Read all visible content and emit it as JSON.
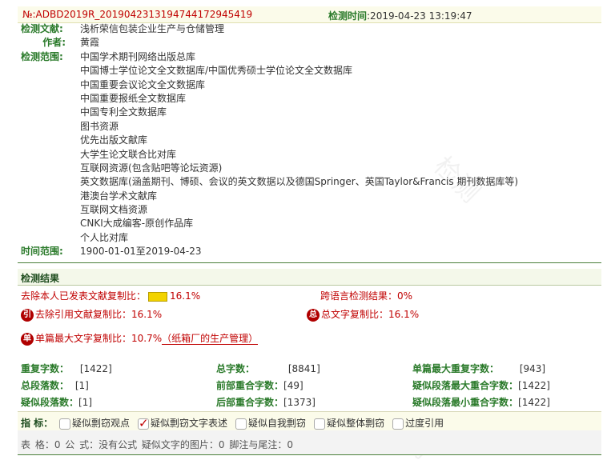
{
  "header": {
    "report_id": "№:ADBD2019R_2019042313194744172945419",
    "date_label": "检测时间",
    "date_value": ":2019-04-23 13:19:47"
  },
  "meta": {
    "doc_label": "检测文献:",
    "doc_value": "浅析荣信包装企业生产与仓储管理",
    "author_label": "作者:",
    "author_value": "黄霞",
    "scope_label": "检测范围:",
    "scope_items": [
      "中国学术期刊网络出版总库",
      "中国博士学位论文全文数据库/中国优秀硕士学位论文全文数据库",
      "中国重要会议论文全文数据库",
      "中国重要报纸全文数据库",
      "中国专利全文数据库",
      "图书资源",
      "优先出版文献库",
      "大学生论文联合比对库",
      "互联网资源(包含贴吧等论坛资源)",
      "英文数据库(涵盖期刊、博硕、会议的英文数据以及德国Springer、英国Taylor&Francis 期刊数据库等)",
      "港澳台学术文献库",
      "互联网文档资源",
      "CNKI大成编客-原创作品库",
      "个人比对库"
    ],
    "time_label": "时间范围:",
    "time_value": "1900-01-01至2019-04-23"
  },
  "results": {
    "title": "检测结果",
    "self_rate_label": "去除本人已发表文献复制比：",
    "self_rate_value": "16.1%",
    "cross_label": "跨语言检测结果：",
    "cross_value": "0%",
    "cite_icon": "引",
    "cite_label": "去除引用文献复制比：",
    "cite_value": "16.1%",
    "total_icon": "总",
    "total_label": "总文字复制比：",
    "total_value": "16.1%",
    "single_icon": "单",
    "single_label": "单篇最大文字复制比：",
    "single_value": "10.7%",
    "single_link": "（纸箱厂的生产管理）"
  },
  "stats": {
    "dup_chars_label": "重复字数：",
    "dup_chars_value": "[1422]",
    "total_chars_label": "总字数：",
    "total_chars_value": "[8841]",
    "single_max_dup_label": "单篇最大重复字数：",
    "single_max_dup_value": "[943]",
    "total_paras_label": "总段落数：",
    "total_paras_value": "[1]",
    "front_overlap_label": "前部重合字数：",
    "front_overlap_value": "[49]",
    "para_max_overlap_label": "疑似段落最大重合字数：",
    "para_max_overlap_value": "[1422]",
    "susp_paras_label": "疑似段落数：",
    "susp_paras_value": "[1]",
    "back_overlap_label": "后部重合字数：",
    "back_overlap_value": "[1373]",
    "para_min_overlap_label": "疑似段落最小重合字数：",
    "para_min_overlap_value": "[1422]"
  },
  "indicators": {
    "label": "指 标：",
    "items": [
      {
        "label": "疑似剽窃观点",
        "checked": false
      },
      {
        "label": "疑似剽窃文字表述",
        "checked": true
      },
      {
        "label": "疑似自我剽窃",
        "checked": false
      },
      {
        "label": "疑似整体剽窃",
        "checked": false
      },
      {
        "label": "过度引用",
        "checked": false
      }
    ]
  },
  "footer": {
    "text": "表 格：0    公 式：没有公式    疑似文字的图片：0    脚注与尾注：0"
  },
  "colors": {
    "accent_red": "#c00000",
    "label_green": "#2a7a2a",
    "rule_green": "#4a7f3a"
  }
}
